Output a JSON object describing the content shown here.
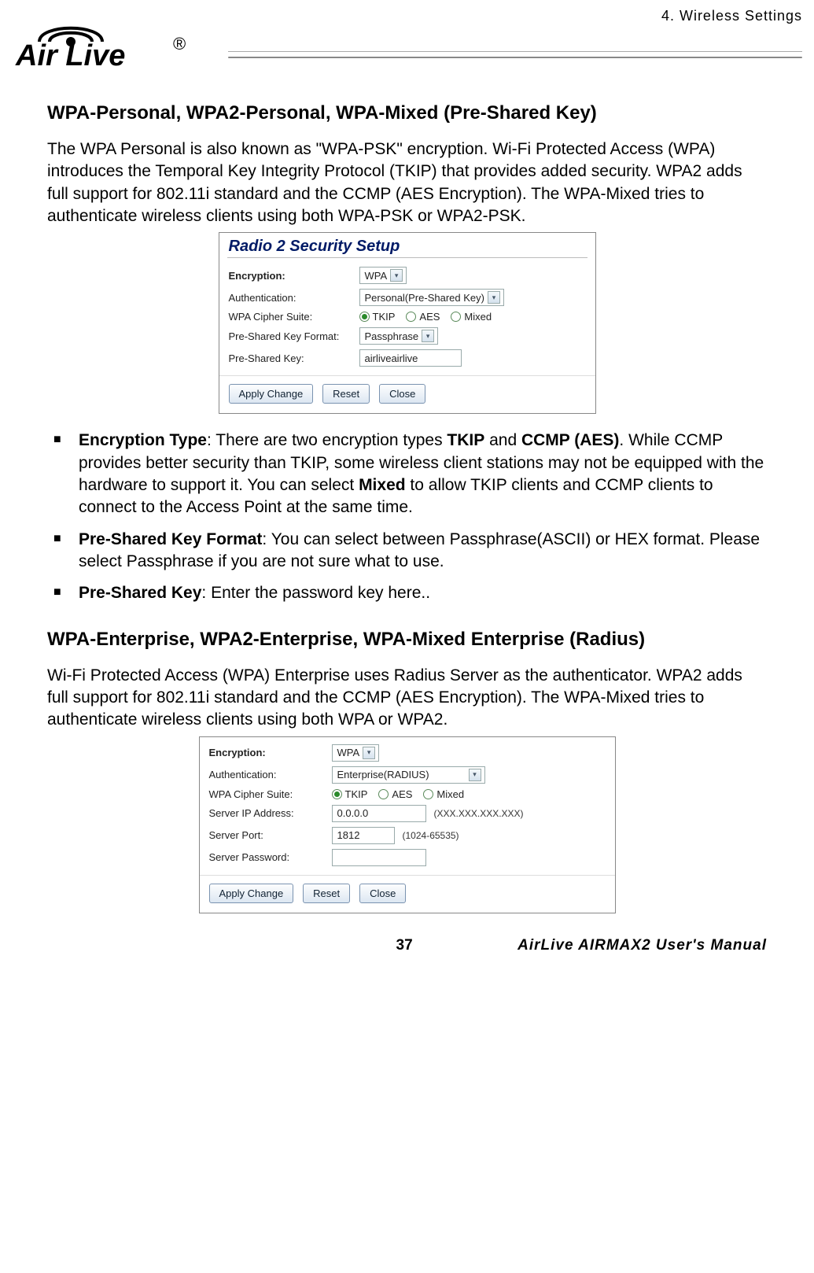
{
  "header": {
    "section_label": "4.  Wireless  Settings",
    "logo_text": "Air Live"
  },
  "section1": {
    "heading": "WPA-Personal, WPA2-Personal, WPA-Mixed (Pre-Shared Key)",
    "paragraph": "The WPA Personal is also known as \"WPA-PSK\" encryption.    Wi-Fi Protected Access (WPA) introduces the Temporal Key Integrity Protocol (TKIP) that provides added security.    WPA2 adds full support for 802.11i standard and the CCMP (AES Encryption). The WPA-Mixed tries to authenticate wireless clients using both WPA-PSK or WPA2-PSK."
  },
  "dialog1": {
    "title": "Radio 2 Security Setup",
    "encryption_label": "Encryption:",
    "encryption_value": "WPA",
    "auth_label": "Authentication:",
    "auth_value": "Personal(Pre-Shared Key)",
    "cipher_label": "WPA Cipher Suite:",
    "cipher_options": {
      "tkip": "TKIP",
      "aes": "AES",
      "mixed": "Mixed"
    },
    "psk_format_label": "Pre-Shared Key Format:",
    "psk_format_value": "Passphrase",
    "psk_label": "Pre-Shared Key:",
    "psk_value": "airliveairlive",
    "buttons": {
      "apply": "Apply Change",
      "reset": "Reset",
      "close": "Close"
    }
  },
  "bullets1": {
    "b1_label": "Encryption Type",
    "b1_text1": ":    There are two encryption types ",
    "b1_bold1": "TKIP",
    "b1_text2": " and ",
    "b1_bold2": "CCMP (AES)",
    "b1_text3": ". While CCMP provides better security than TKIP, some wireless client stations may not be equipped with the hardware to support it. You can select ",
    "b1_bold3": "Mixed",
    "b1_text4": " to allow TKIP clients and CCMP clients to connect to the Access Point at the same time.",
    "b2_label": "Pre-Shared Key Format",
    "b2_text": ":    You can select between Passphrase(ASCII) or HEX format.    Please select Passphrase if you are not sure what to use.",
    "b3_label": "Pre-Shared Key",
    "b3_text": ":    Enter the password key here.."
  },
  "section2": {
    "heading": "WPA-Enterprise, WPA2-Enterprise, WPA-Mixed Enterprise (Radius)",
    "paragraph": "Wi-Fi Protected Access (WPA) Enterprise uses Radius Server as the authenticator. WPA2 adds full support for 802.11i standard and the CCMP (AES Encryption).    The WPA-Mixed tries to authenticate wireless clients using both WPA or WPA2."
  },
  "dialog2": {
    "encryption_label": "Encryption:",
    "encryption_value": "WPA",
    "auth_label": "Authentication:",
    "auth_value": "Enterprise(RADIUS)",
    "cipher_label": "WPA Cipher Suite:",
    "cipher_options": {
      "tkip": "TKIP",
      "aes": "AES",
      "mixed": "Mixed"
    },
    "ip_label": "Server IP Address:",
    "ip_value": "0.0.0.0",
    "ip_hint": "(XXX.XXX.XXX.XXX)",
    "port_label": "Server Port:",
    "port_value": "1812",
    "port_hint": "(1024-65535)",
    "pass_label": "Server Password:",
    "pass_value": "",
    "buttons": {
      "apply": "Apply Change",
      "reset": "Reset",
      "close": "Close"
    }
  },
  "footer": {
    "page_num": "37",
    "manual": "AirLive  AIRMAX2  User's  Manual"
  }
}
